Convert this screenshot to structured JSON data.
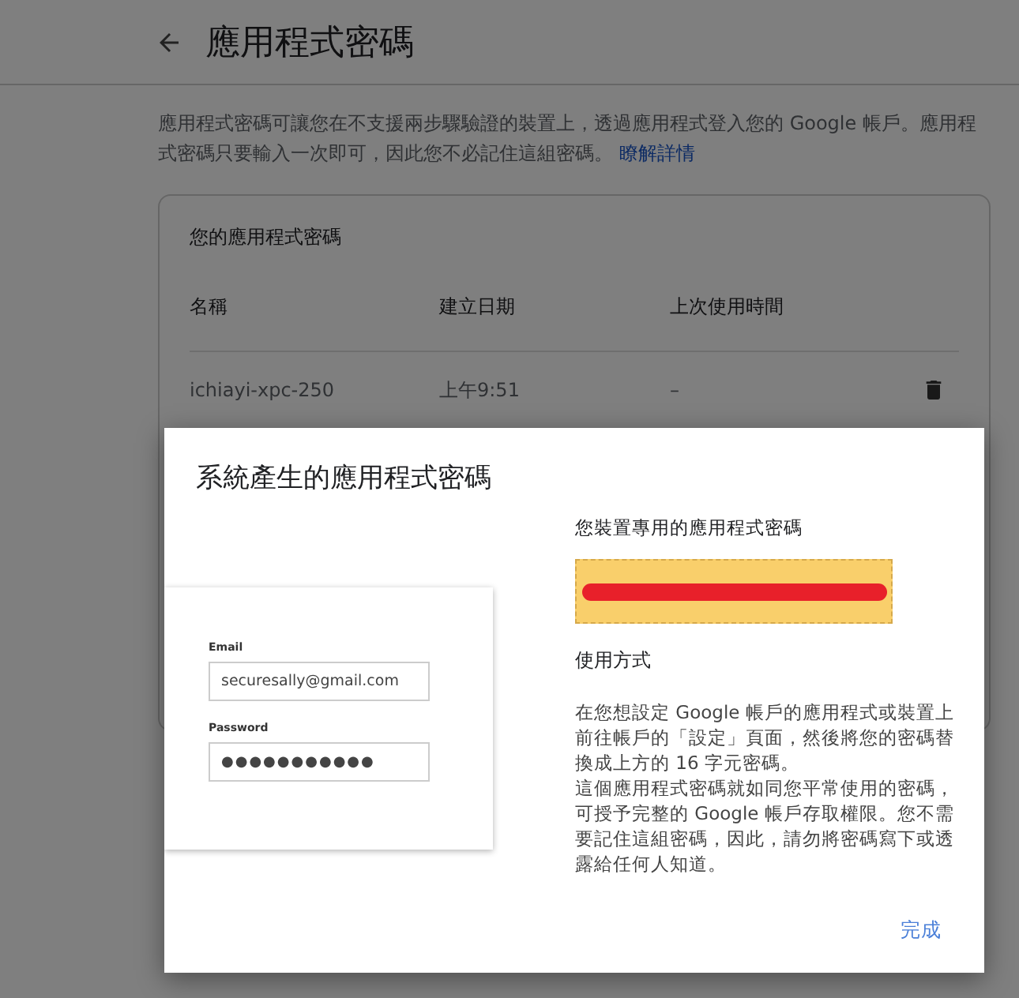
{
  "page": {
    "title": "應用程式密碼",
    "description": "應用程式密碼可讓您在不支援兩步驟驗證的裝置上，透過應用程式登入您的 Google 帳戶。應用程式密碼只要輸入一次即可，因此您不必記住這組密碼。",
    "learn_more": "瞭解詳情"
  },
  "card": {
    "title": "您的應用程式密碼",
    "columns": [
      "名稱",
      "建立日期",
      "上次使用時間"
    ],
    "rows": [
      {
        "name": "ichiayi-xpc-250",
        "created": "上午9:51",
        "last_used": "–"
      }
    ]
  },
  "dialog": {
    "title": "系統產生的應用程式密碼",
    "illustration": {
      "email_label": "Email",
      "email_value": "securesally@gmail.com",
      "password_label": "Password",
      "password_value": "●●●●●●●●●●●"
    },
    "password_label": "您裝置專用的應用程式密碼",
    "usage_title": "使用方式",
    "instructions": [
      "在您想設定 Google 帳戶的應用程式或裝置上前往帳戶的「設定」頁面，然後將您的密碼替換成上方的 16 字元密碼。",
      "這個應用程式密碼就如同您平常使用的密碼，可授予完整的 Google 帳戶存取權限。您不需要記住這組密碼，因此，請勿將密碼寫下或透露給任何人知道。"
    ],
    "done_button": "完成"
  }
}
